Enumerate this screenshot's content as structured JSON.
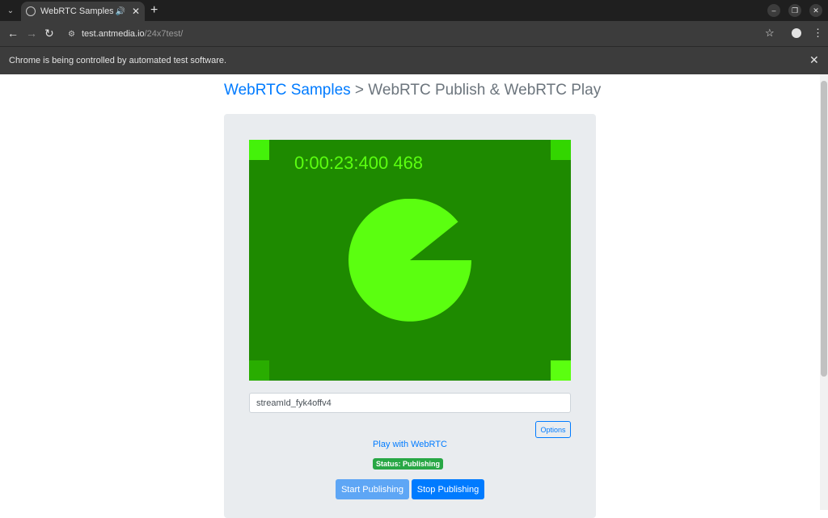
{
  "browser": {
    "tab_title": "WebRTC Samples > P",
    "tab_close": "✕",
    "new_tab": "+",
    "url_host": "test.antmedia.io",
    "url_path": "/24x7test/",
    "infobar_message": "Chrome is being controlled by automated test software.",
    "infobar_close": "✕",
    "window_controls": {
      "minimize": "–",
      "restore": "❐",
      "close": "✕"
    },
    "icons": {
      "back": "←",
      "forward": "→",
      "reload": "↻",
      "star": "☆",
      "menu": "⋮",
      "speaker": "🔊",
      "site_info": "⚙"
    }
  },
  "page": {
    "breadcrumb_link": "WebRTC Samples",
    "breadcrumb_rest": " > WebRTC Publish & WebRTC Play",
    "video": {
      "timecode": "0:00:23:400 468",
      "background": "#1e8a00",
      "accent": "#5bff10"
    },
    "stream_id_value": "streamId_fyk4offv4",
    "options_label": "Options",
    "play_link": "Play with WebRTC",
    "status_badge": "Status: Publishing",
    "start_button": "Start Publishing",
    "stop_button": "Stop Publishing"
  },
  "colors": {
    "link": "#007bff",
    "success": "#28a745",
    "panel_bg": "#e9ecef"
  }
}
